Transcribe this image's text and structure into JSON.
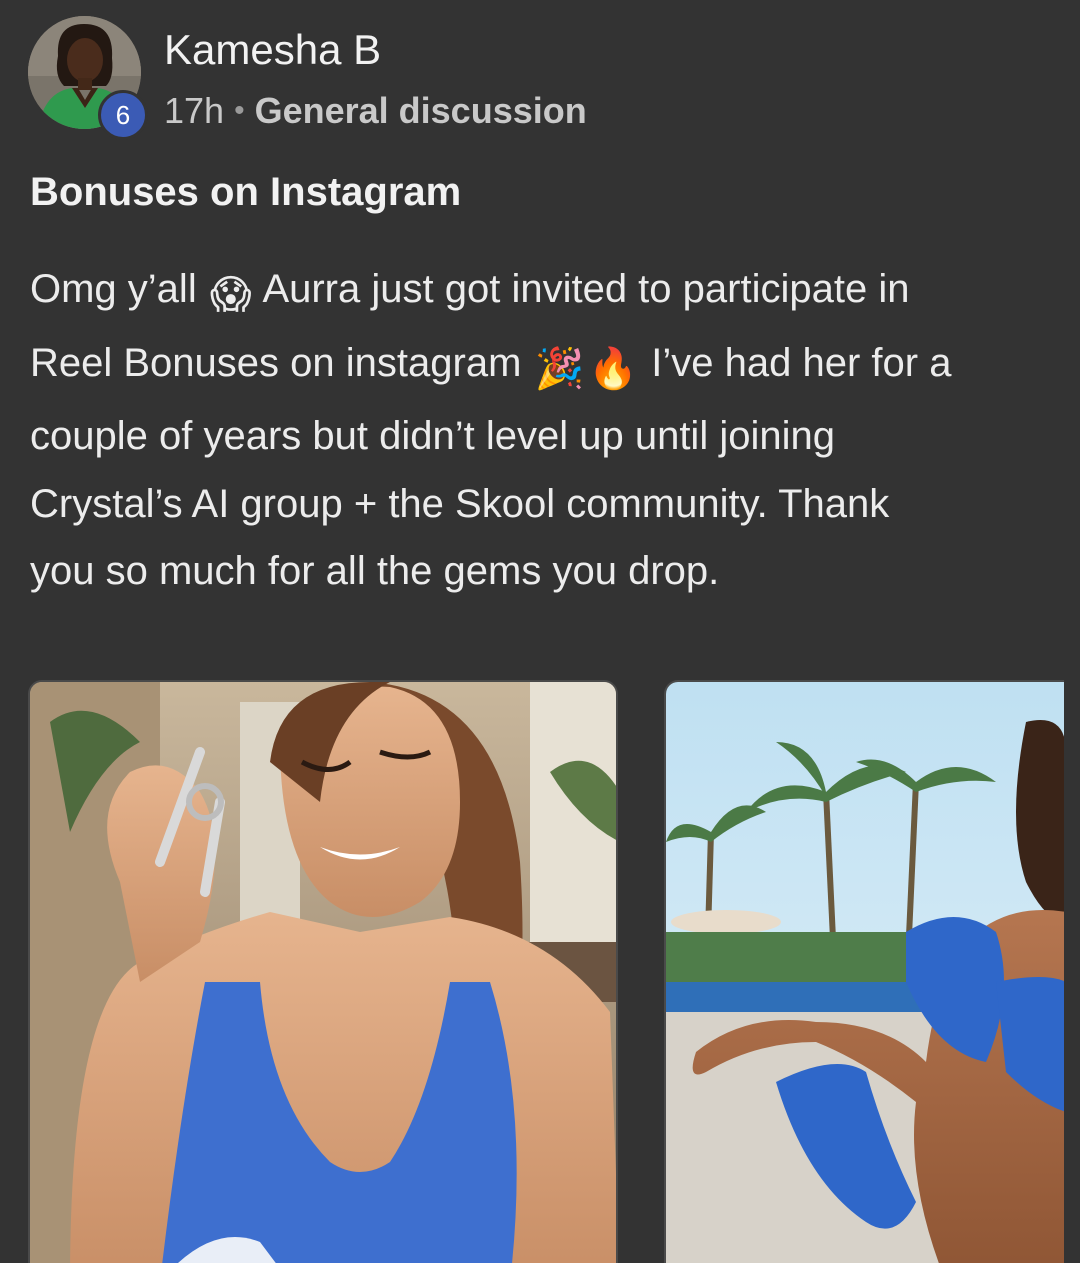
{
  "post": {
    "author": {
      "name": "Kamesha B",
      "level": "6",
      "avatar_icon": "profile-photo-woman"
    },
    "meta": {
      "time": "17h",
      "separator": "•",
      "category": "General discussion"
    },
    "title": "Bonuses on Instagram",
    "body": {
      "line1_a": "Omg y’all",
      "line1_emoji": "😱",
      "line1_b": "Aurra just got invited to participate in",
      "line2_a": "Reel Bonuses on instagram",
      "line2_emoji_1": "🎉",
      "line2_emoji_2": "🔥",
      "line2_b": "I’ve had her for a",
      "line3": "couple of years but didn’t level up until joining",
      "line4": "Crystal’s AI group + the Skool community. Thank",
      "line5": "you so much for all the gems you drop."
    },
    "attachments": [
      {
        "icon": "photo-woman-holding-keys"
      },
      {
        "icon": "photo-woman-poolside-palm-trees"
      }
    ]
  },
  "colors": {
    "background": "#333333",
    "level_badge": "#3b5bb5",
    "text_primary": "#f2f2f2",
    "text_secondary": "#c9c9c9"
  }
}
